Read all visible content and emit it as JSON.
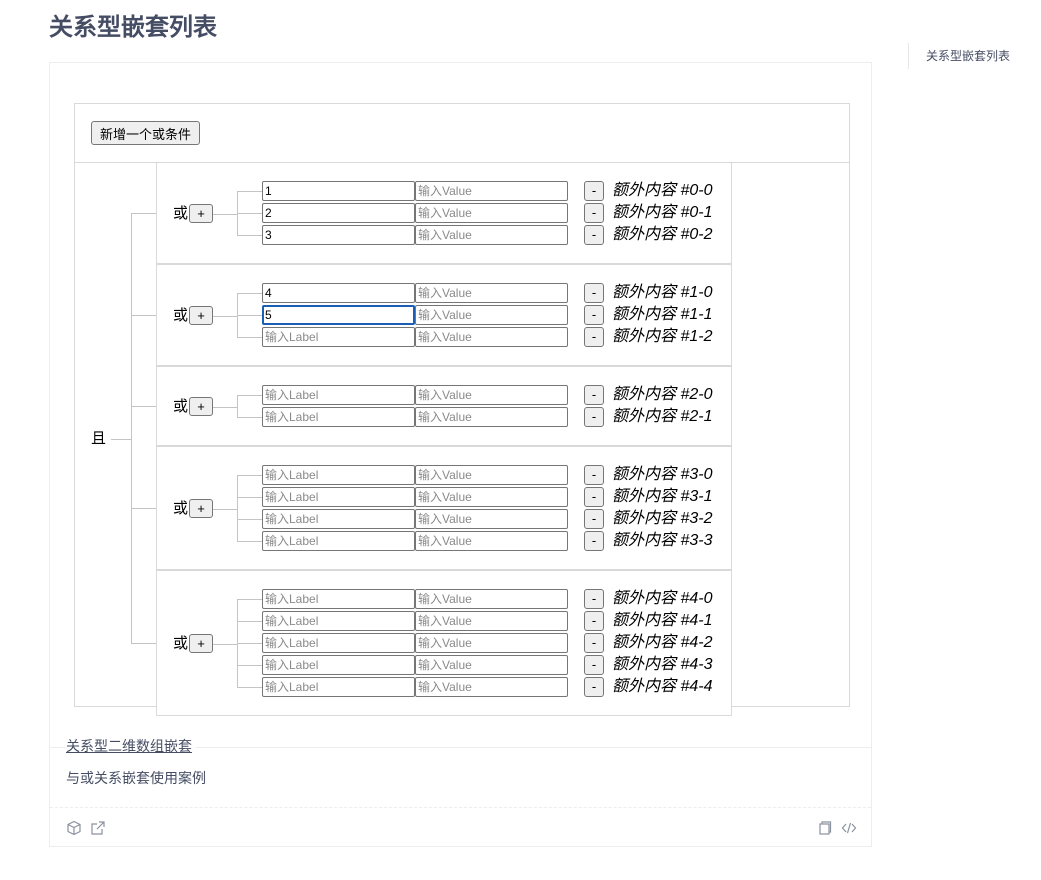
{
  "page_title": "关系型嵌套列表",
  "toc": {
    "items": [
      "关系型嵌套列表"
    ]
  },
  "demo": {
    "add_or_button": "新增一个或条件",
    "and_label": "且",
    "or_label": "或",
    "plus_label": "+",
    "minus_label": "-",
    "placeholders": {
      "label": "输入Label",
      "value": "输入Value"
    },
    "groups": [
      {
        "rows": [
          {
            "label": "1",
            "value": "",
            "extra": "额外内容 #0-0"
          },
          {
            "label": "2",
            "value": "",
            "extra": "额外内容 #0-1"
          },
          {
            "label": "3",
            "value": "",
            "extra": "额外内容 #0-2"
          }
        ]
      },
      {
        "rows": [
          {
            "label": "4",
            "value": "",
            "extra": "额外内容 #1-0"
          },
          {
            "label": "5",
            "value": "",
            "extra": "额外内容 #1-1"
          },
          {
            "label": "",
            "value": "",
            "extra": "额外内容 #1-2"
          }
        ]
      },
      {
        "rows": [
          {
            "label": "",
            "value": "",
            "extra": "额外内容 #2-0"
          },
          {
            "label": "",
            "value": "",
            "extra": "额外内容 #2-1"
          }
        ]
      },
      {
        "rows": [
          {
            "label": "",
            "value": "",
            "extra": "额外内容 #3-0"
          },
          {
            "label": "",
            "value": "",
            "extra": "额外内容 #3-1"
          },
          {
            "label": "",
            "value": "",
            "extra": "额外内容 #3-2"
          },
          {
            "label": "",
            "value": "",
            "extra": "额外内容 #3-3"
          }
        ]
      },
      {
        "rows": [
          {
            "label": "",
            "value": "",
            "extra": "额外内容 #4-0"
          },
          {
            "label": "",
            "value": "",
            "extra": "额外内容 #4-1"
          },
          {
            "label": "",
            "value": "",
            "extra": "额外内容 #4-2"
          },
          {
            "label": "",
            "value": "",
            "extra": "额外内容 #4-3"
          },
          {
            "label": "",
            "value": "",
            "extra": "额外内容 #4-4"
          }
        ]
      }
    ]
  },
  "meta": {
    "title": "关系型二维数组嵌套",
    "description": "与或关系嵌套使用案例"
  },
  "actions": {
    "left_icons": [
      "codesandbox-icon",
      "open-external-icon"
    ],
    "right_icons": [
      "copy-icon",
      "code-icon"
    ]
  }
}
